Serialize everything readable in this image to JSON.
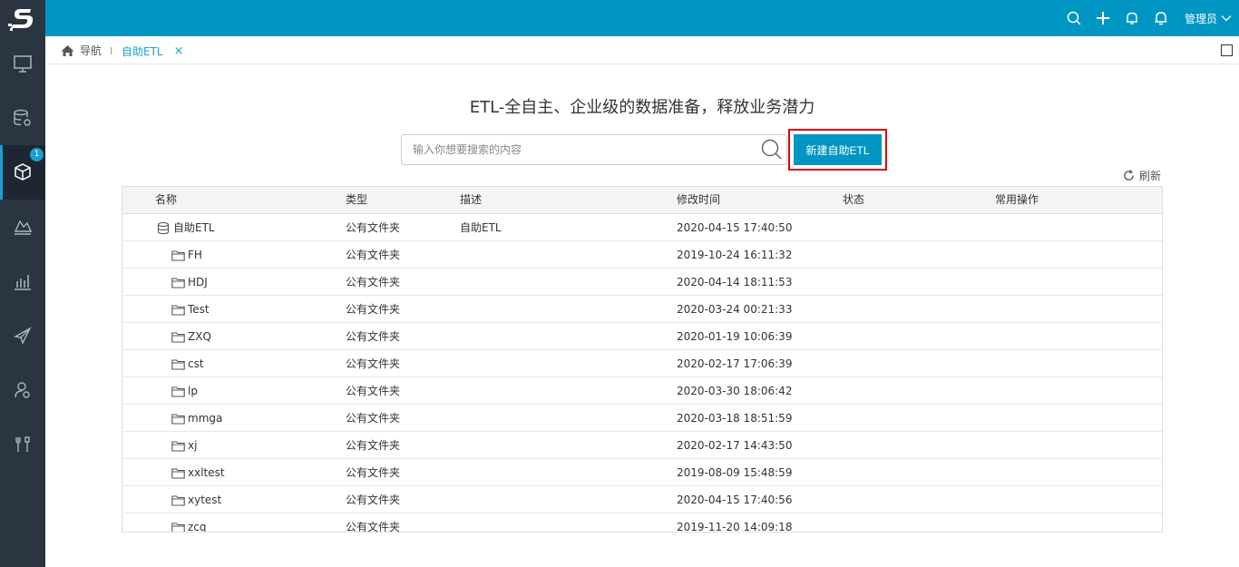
{
  "header": {
    "user_label": "管理员",
    "icons": [
      "search-icon",
      "plus-icon",
      "bell-outline-icon",
      "bell-icon",
      "chevron-down-icon"
    ]
  },
  "sidebar": {
    "logo": "S",
    "items": [
      {
        "icon": "monitor-icon"
      },
      {
        "icon": "database-settings-icon"
      },
      {
        "icon": "cube-icon",
        "badge": "1",
        "active": true
      },
      {
        "icon": "trend-area-icon"
      },
      {
        "icon": "bar-chart-icon"
      },
      {
        "icon": "paper-plane-icon"
      },
      {
        "icon": "user-settings-icon"
      },
      {
        "icon": "tools-icon"
      }
    ]
  },
  "tabbar": {
    "home_label": "导航",
    "active_tab": "自助ETL",
    "close_symbol": "×"
  },
  "main": {
    "title": "ETL-全自主、企业级的数据准备，释放业务潜力",
    "search_placeholder": "输入你想要搜索的内容",
    "new_button": "新建自助ETL",
    "refresh_label": "刷新"
  },
  "table": {
    "columns": [
      "名称",
      "类型",
      "描述",
      "修改时间",
      "状态",
      "常用操作"
    ],
    "rows": [
      {
        "name": "自助ETL",
        "type": "公有文件夹",
        "desc": "自助ETL",
        "time": "2020-04-15 17:40:50",
        "icon": "database-icon",
        "level": 0
      },
      {
        "name": "FH",
        "type": "公有文件夹",
        "desc": "",
        "time": "2019-10-24 16:11:32",
        "icon": "folder-icon",
        "level": 1
      },
      {
        "name": "HDJ",
        "type": "公有文件夹",
        "desc": "",
        "time": "2020-04-14 18:11:53",
        "icon": "folder-icon",
        "level": 1
      },
      {
        "name": "Test",
        "type": "公有文件夹",
        "desc": "",
        "time": "2020-03-24 00:21:33",
        "icon": "folder-icon",
        "level": 1
      },
      {
        "name": "ZXQ",
        "type": "公有文件夹",
        "desc": "",
        "time": "2020-01-19 10:06:39",
        "icon": "folder-icon",
        "level": 1
      },
      {
        "name": "cst",
        "type": "公有文件夹",
        "desc": "",
        "time": "2020-02-17 17:06:39",
        "icon": "folder-icon",
        "level": 1
      },
      {
        "name": "lp",
        "type": "公有文件夹",
        "desc": "",
        "time": "2020-03-30 18:06:42",
        "icon": "folder-icon",
        "level": 1
      },
      {
        "name": "mmga",
        "type": "公有文件夹",
        "desc": "",
        "time": "2020-03-18 18:51:59",
        "icon": "folder-icon",
        "level": 1
      },
      {
        "name": "xj",
        "type": "公有文件夹",
        "desc": "",
        "time": "2020-02-17 14:43:50",
        "icon": "folder-icon",
        "level": 1
      },
      {
        "name": "xxltest",
        "type": "公有文件夹",
        "desc": "",
        "time": "2019-08-09 15:48:59",
        "icon": "folder-icon",
        "level": 1
      },
      {
        "name": "xytest",
        "type": "公有文件夹",
        "desc": "",
        "time": "2020-04-15 17:40:56",
        "icon": "folder-icon",
        "level": 1
      },
      {
        "name": "zcq",
        "type": "公有文件夹",
        "desc": "",
        "time": "2019-11-20 14:09:18",
        "icon": "folder-icon",
        "level": 1
      }
    ]
  },
  "colors": {
    "topbar": "#0096c3",
    "sidebar": "#2b3542",
    "accent": "#1a9fd0",
    "highlight_border": "#e00000"
  }
}
